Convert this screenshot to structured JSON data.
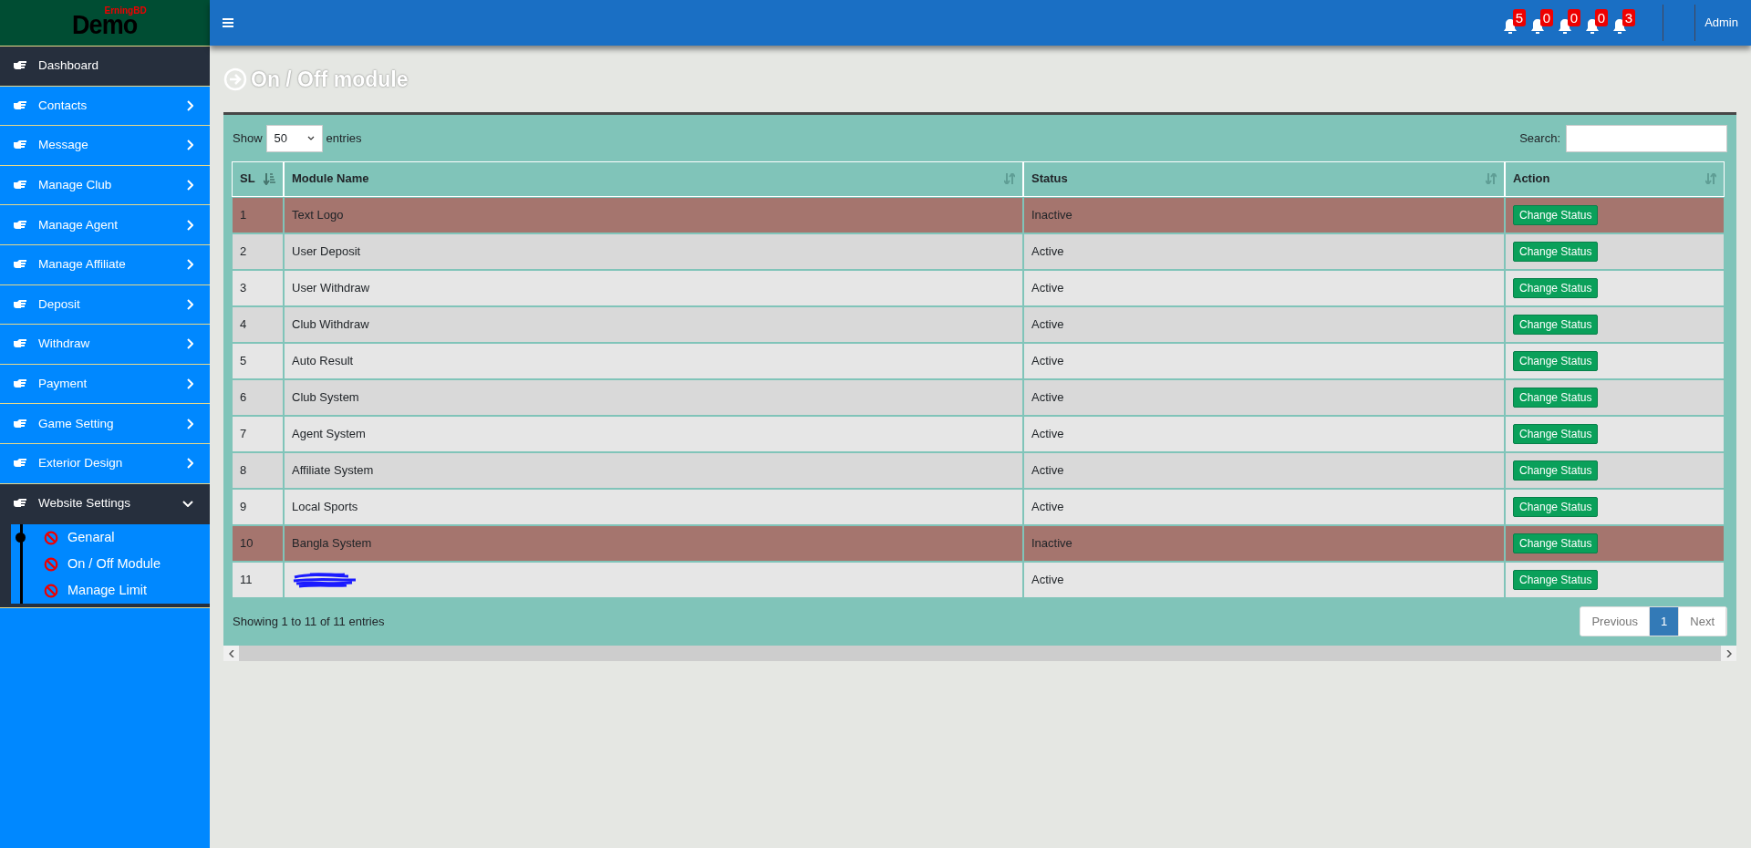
{
  "brand": {
    "logo": "Demo",
    "tagline": "ErningBD"
  },
  "header": {
    "notifications": [
      {
        "count": "5"
      },
      {
        "count": "0"
      },
      {
        "count": "0"
      },
      {
        "count": "0"
      },
      {
        "count": "3"
      }
    ],
    "user": "Admin"
  },
  "sidebar": {
    "items": [
      {
        "label": "Dashboard",
        "kind": "link",
        "highlighted": true
      },
      {
        "label": "Contacts",
        "kind": "menu",
        "highlighted": false,
        "expanded": false
      },
      {
        "label": "Message",
        "kind": "menu",
        "highlighted": false,
        "expanded": false
      },
      {
        "label": "Manage Club",
        "kind": "menu",
        "highlighted": false,
        "expanded": false
      },
      {
        "label": "Manage Agent",
        "kind": "menu",
        "highlighted": false,
        "expanded": false
      },
      {
        "label": "Manage Affiliate",
        "kind": "menu",
        "highlighted": false,
        "expanded": false
      },
      {
        "label": "Deposit",
        "kind": "menu",
        "highlighted": false,
        "expanded": false
      },
      {
        "label": "Withdraw",
        "kind": "menu",
        "highlighted": false,
        "expanded": false
      },
      {
        "label": "Payment",
        "kind": "menu",
        "highlighted": false,
        "expanded": false
      },
      {
        "label": "Game Setting",
        "kind": "menu",
        "highlighted": false,
        "expanded": false
      },
      {
        "label": "Exterior Design",
        "kind": "menu",
        "highlighted": false,
        "expanded": false
      },
      {
        "label": "Website Settings",
        "kind": "menu",
        "highlighted": true,
        "expanded": true,
        "children": [
          {
            "label": "Genaral",
            "selected": true
          },
          {
            "label": "On / Off Module",
            "selected": false
          },
          {
            "label": "Manage Limit",
            "selected": false
          }
        ]
      }
    ]
  },
  "page": {
    "title": "On / Off module"
  },
  "table": {
    "show_label": "Show",
    "page_size": "50",
    "entries_label": "entries",
    "search_label": "Search:",
    "columns": [
      {
        "label": "SL",
        "sorted": true
      },
      {
        "label": "Module Name",
        "sorted": false
      },
      {
        "label": "Status",
        "sorted": false
      },
      {
        "label": "Action",
        "sorted": false
      }
    ],
    "rows": [
      {
        "sl": "1",
        "name": "Text Logo",
        "status": "Inactive",
        "active": false,
        "action": "Change Status"
      },
      {
        "sl": "2",
        "name": "User Deposit",
        "status": "Active",
        "active": true,
        "action": "Change Status"
      },
      {
        "sl": "3",
        "name": "User Withdraw",
        "status": "Active",
        "active": true,
        "action": "Change Status"
      },
      {
        "sl": "4",
        "name": "Club Withdraw",
        "status": "Active",
        "active": true,
        "action": "Change Status"
      },
      {
        "sl": "5",
        "name": "Auto Result",
        "status": "Active",
        "active": true,
        "action": "Change Status"
      },
      {
        "sl": "6",
        "name": "Club System",
        "status": "Active",
        "active": true,
        "action": "Change Status"
      },
      {
        "sl": "7",
        "name": "Agent System",
        "status": "Active",
        "active": true,
        "action": "Change Status"
      },
      {
        "sl": "8",
        "name": "Affiliate System",
        "status": "Active",
        "active": true,
        "action": "Change Status"
      },
      {
        "sl": "9",
        "name": "Local Sports",
        "status": "Active",
        "active": true,
        "action": "Change Status"
      },
      {
        "sl": "10",
        "name": "Bangla System",
        "status": "Inactive",
        "active": false,
        "action": "Change Status"
      },
      {
        "sl": "11",
        "redacted": true,
        "status": "Active",
        "active": true,
        "action": "Change Status"
      }
    ],
    "info": "Showing 1 to 11 of 11 entries",
    "pagination": [
      {
        "label": "Previous",
        "selected": false
      },
      {
        "label": "1",
        "selected": true
      },
      {
        "label": "Next",
        "selected": false
      }
    ]
  }
}
